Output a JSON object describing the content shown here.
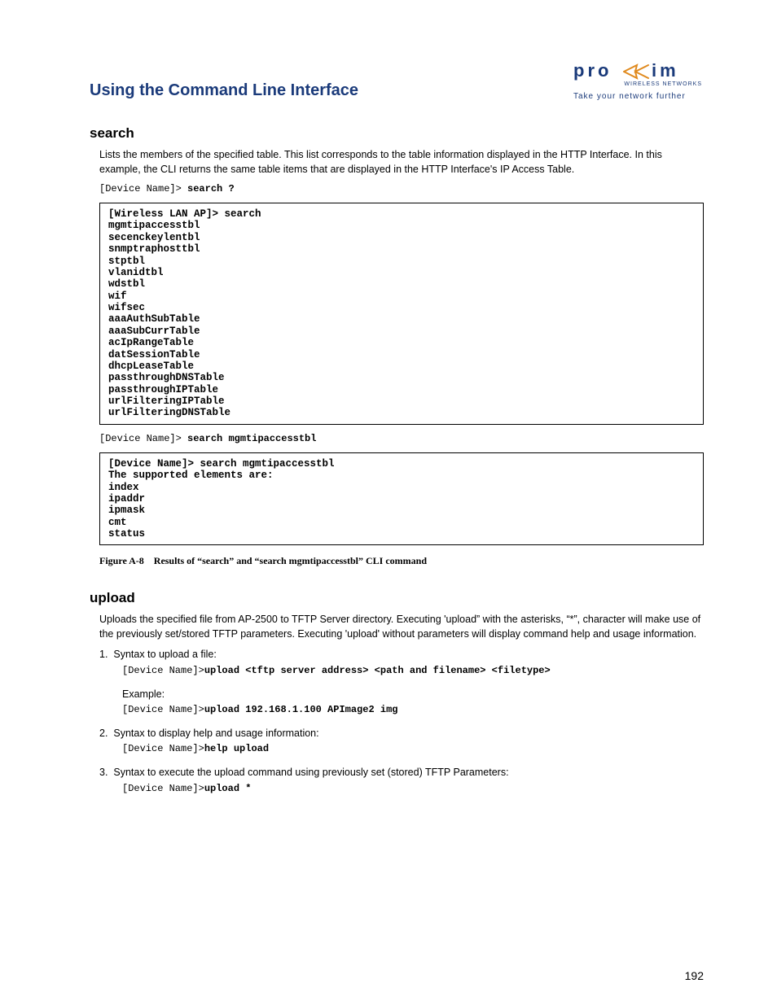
{
  "header": {
    "chapter_title": "Using the Command Line Interface",
    "logo_text": "proxim",
    "logo_sub": "WIRELESS NETWORKS",
    "tagline": "Take your network further"
  },
  "search": {
    "heading": "search",
    "intro": "Lists the members of the specified table. This list corresponds to the table information displayed in the HTTP Interface. In this example, the CLI returns the same table items that are displayed in the HTTP Interface's IP Access Table.",
    "cmd1_prompt": "[Device Name]>",
    "cmd1_cmd": "search ?",
    "term1": "[Wireless LAN AP]> search\nmgmtipaccesstbl\nsecenckeylentbl\nsnmptraphosttbl\nstptbl\nvlanidtbl\nwdstbl\nwif\nwifsec\naaaAuthSubTable\naaaSubCurrTable\nacIpRangeTable\ndatSessionTable\ndhcpLeaseTable\npassthroughDNSTable\npassthroughIPTable\nurlFilteringIPTable\nurlFilteringDNSTable",
    "cmd2_prompt": "[Device Name]>",
    "cmd2_cmd": "search mgmtipaccesstbl",
    "term2": "[Device Name]> search mgmtipaccesstbl\nThe supported elements are:\nindex\nipaddr\nipmask\ncmt\nstatus",
    "figure_caption": "Figure A-8 Results of “search” and “search mgmtipaccesstbl” CLI command"
  },
  "upload": {
    "heading": "upload",
    "intro": "Uploads the specified file from AP-2500 to TFTP Server directory. Executing 'upload” with the asterisks, “*”, character will make use of the previously set/stored TFTP parameters. Executing 'upload' without parameters will display command help and usage information.",
    "item1_lead": "1.  Syntax to upload a file:",
    "item1_prompt": "[Device Name]>",
    "item1_cmd": "upload <tftp server address> <path and filename> <filetype>",
    "example_label": "Example:",
    "example_prompt": "[Device Name]>",
    "example_cmd": "upload 192.168.1.100 APImage2 img",
    "item2_lead": "2.  Syntax to display help and usage information:",
    "item2_prompt": "[Device Name]>",
    "item2_cmd": "help upload",
    "item3_lead": "3.  Syntax to execute the upload command using previously set (stored) TFTP Parameters:",
    "item3_prompt": "[Device Name]>",
    "item3_cmd": "upload *"
  },
  "page_number": "192"
}
